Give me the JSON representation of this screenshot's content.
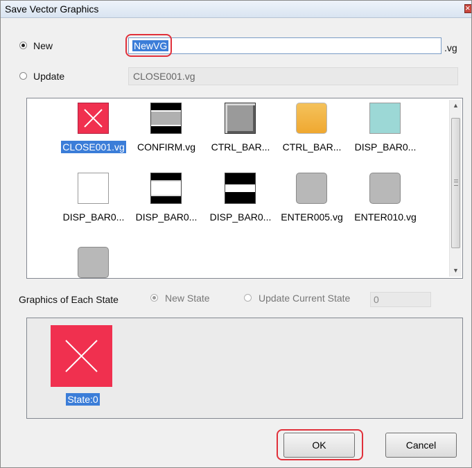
{
  "window": {
    "title": "Save Vector Graphics"
  },
  "new_option": {
    "label": "New",
    "checked": true,
    "name_value": "NewVG",
    "extension": ".vg"
  },
  "update_option": {
    "label": "Update",
    "checked": false,
    "current_file": "CLOSE001.vg"
  },
  "graphics_list": {
    "items": [
      {
        "label": "CLOSE001.vg",
        "icon": "red-x-thumbnail",
        "selected": true
      },
      {
        "label": "CONFIRM.vg",
        "icon": "black-bars-gray-thumbnail",
        "selected": false
      },
      {
        "label": "CTRL_BAR...",
        "icon": "gray-beveled-thumbnail",
        "selected": false
      },
      {
        "label": "CTRL_BAR...",
        "icon": "orange-rounded-thumbnail",
        "selected": false
      },
      {
        "label": "DISP_BAR0...",
        "icon": "teal-square-thumbnail",
        "selected": false
      },
      {
        "label": "DISP_BAR0...",
        "icon": "white-square-thumbnail",
        "selected": false
      },
      {
        "label": "DISP_BAR0...",
        "icon": "black-bars-white-thumbnail",
        "selected": false
      },
      {
        "label": "DISP_BAR0...",
        "icon": "black-bars-white-thumbnail",
        "selected": false
      },
      {
        "label": "ENTER005.vg",
        "icon": "gray-rounded-thumbnail",
        "selected": false
      },
      {
        "label": "ENTER010.vg",
        "icon": "gray-rounded-thumbnail",
        "selected": false
      },
      {
        "label": "",
        "icon": "gray-rounded-thumbnail",
        "selected": false
      }
    ]
  },
  "state_section": {
    "label": "Graphics of Each State",
    "new_state_label": "New State",
    "update_state_label": "Update Current State",
    "state_value": "0",
    "state_item_label": "State:0"
  },
  "buttons": {
    "ok": "OK",
    "cancel": "Cancel"
  },
  "colors": {
    "selection": "#3b7dd8",
    "highlight": "#e0303a",
    "close_red": "#f0304f"
  }
}
